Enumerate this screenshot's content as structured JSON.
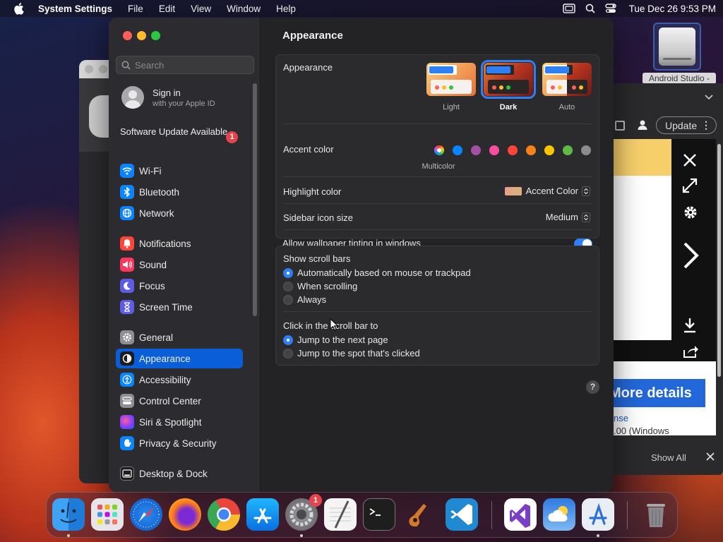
{
  "menubar": {
    "app_name": "System Settings",
    "items": [
      "File",
      "Edit",
      "View",
      "Window",
      "Help"
    ],
    "clock": "Tue Dec 26  9:53 PM"
  },
  "desktop": {
    "drive_label": "Android Studio -"
  },
  "browser": {
    "update_label": "Update",
    "more_button": "More details",
    "link_text": "nse",
    "link_text2": ".00 (Windows",
    "show_all": "Show All"
  },
  "sidebar": {
    "search_placeholder": "Search",
    "sign_in_title": "Sign in",
    "sign_in_sub": "with your Apple ID",
    "update_text": "Software Update Available",
    "update_badge": "1",
    "items": [
      {
        "label": "Wi-Fi",
        "color": "#0a84ff",
        "icon": "wifi-icon"
      },
      {
        "label": "Bluetooth",
        "color": "#0a84ff",
        "icon": "bluetooth-icon"
      },
      {
        "label": "Network",
        "color": "#0a84ff",
        "icon": "globe-icon"
      },
      {
        "label": "Notifications",
        "color": "#ff453a",
        "icon": "bell-icon"
      },
      {
        "label": "Sound",
        "color": "#ff375f",
        "icon": "speaker-icon"
      },
      {
        "label": "Focus",
        "color": "#5e5ce6",
        "icon": "moon-icon"
      },
      {
        "label": "Screen Time",
        "color": "#5e5ce6",
        "icon": "hourglass-icon"
      },
      {
        "label": "General",
        "color": "#8e8e93",
        "icon": "gear-icon"
      },
      {
        "label": "Appearance",
        "color": "#1c1c1e",
        "icon": "appearance-icon"
      },
      {
        "label": "Accessibility",
        "color": "#0a84ff",
        "icon": "accessibility-icon"
      },
      {
        "label": "Control Center",
        "color": "#8e8e93",
        "icon": "toggles-icon"
      },
      {
        "label": "Siri & Spotlight",
        "color": "#bf5af2",
        "icon": "siri-icon"
      },
      {
        "label": "Privacy & Security",
        "color": "#0a84ff",
        "icon": "hand-icon"
      },
      {
        "label": "Desktop & Dock",
        "color": "#1c1c1e",
        "icon": "dock-icon"
      }
    ]
  },
  "main": {
    "title": "Appearance",
    "appearance_label": "Appearance",
    "themes": [
      {
        "label": "Light",
        "selected": false
      },
      {
        "label": "Dark",
        "selected": true
      },
      {
        "label": "Auto",
        "selected": false
      }
    ],
    "accent_label": "Accent color",
    "accent_colors": [
      "multicolor",
      "#0a84ff",
      "#a550a7",
      "#f74f9e",
      "#ff453a",
      "#f7821b",
      "#ffc600",
      "#62ba46",
      "#8c8c8c"
    ],
    "accent_caption": "Multicolor",
    "highlight_label": "Highlight color",
    "highlight_value": "Accent Color",
    "sidebar_icon_label": "Sidebar icon size",
    "sidebar_icon_value": "Medium",
    "tinting_label": "Allow wallpaper tinting in windows",
    "tinting_on": true,
    "scroll_label": "Show scroll bars",
    "scroll_options": [
      {
        "label": "Automatically based on mouse or trackpad",
        "selected": true
      },
      {
        "label": "When scrolling",
        "selected": false
      },
      {
        "label": "Always",
        "selected": false
      }
    ],
    "click_label": "Click in the scroll bar to",
    "click_options": [
      {
        "label": "Jump to the next page",
        "selected": true
      },
      {
        "label": "Jump to the spot that's clicked",
        "selected": false
      }
    ],
    "help": "?"
  },
  "dock": {
    "apps": [
      "finder-icon",
      "launchpad-icon",
      "safari-icon",
      "firefox-icon",
      "chrome-icon",
      "app-store-icon",
      "system-settings-icon",
      "textedit-icon",
      "terminal-icon",
      "garageband-icon",
      "vscode-icon",
      "visual-studio-icon",
      "weather-icon",
      "xcode-instruments-icon",
      "trash-icon"
    ],
    "settings_badge": "1"
  }
}
